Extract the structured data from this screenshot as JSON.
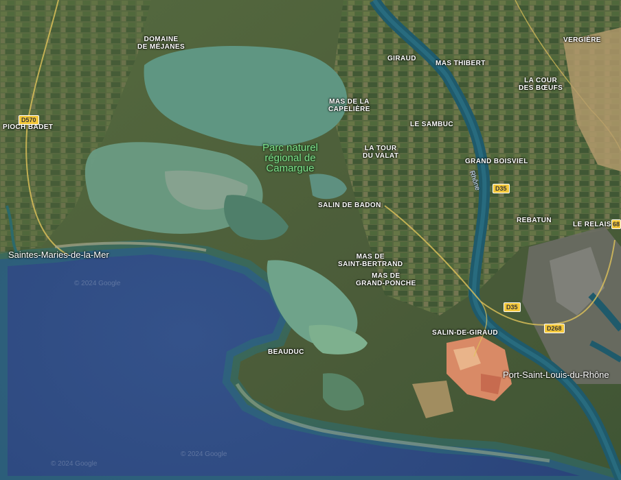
{
  "map": {
    "park": "Parc naturel\nrégional de\nCamargue",
    "places": {
      "domaine_mejanes": "DOMAINE\nDE MÉJANES",
      "pioch_badet": "PIOCH BADET",
      "giraud": "GIRAUD",
      "mas_thibert": "MAS THIBERT",
      "vergiere": "VERGIÈRE",
      "la_cour_boeufs": "LA COUR\nDES BŒUFS",
      "mas_capeliere": "MAS DE LA\nCAPELIÈRE",
      "le_sambuc": "LE SAMBUC",
      "la_tour_valat": "LA TOUR\nDU VALAT",
      "grand_boisviel": "GRAND BOISVIEL",
      "salin_badon": "SALIN DE BADON",
      "rebatun": "REBATUN",
      "le_relais": "LE RELAIS",
      "mas_saint_bertrand": "MAS DE\nSAINT-BERTRAND",
      "mas_grand_ponche": "MAS DE\nGRAND-PONCHE",
      "salin_giraud": "SALIN-DE-GIRAUD",
      "beauduc": "BEAUDUC"
    },
    "towns": {
      "saintes_maries": "Saintes-Maries-de-la-Mer",
      "port_saint_louis": "Port-Saint-Louis-du-Rhône"
    },
    "river": "Rhône",
    "roads": {
      "d570": "D570",
      "d35_a": "D35",
      "d35_b": "D35",
      "d268": "D268",
      "d268_edge": "68"
    },
    "watermarks": [
      "© 2024 Google",
      "© 2024 Google",
      "© 2024 Google"
    ],
    "colors": {
      "sea": "#2f4a7e",
      "coast": "#2a6b74",
      "land": "#4a5b39",
      "lagoon": "#5f9a82",
      "salt_pans": "#d98a66",
      "river": "#1f5a6b",
      "road_badge": "#f4c83b",
      "park_label": "#7fe08a"
    }
  }
}
